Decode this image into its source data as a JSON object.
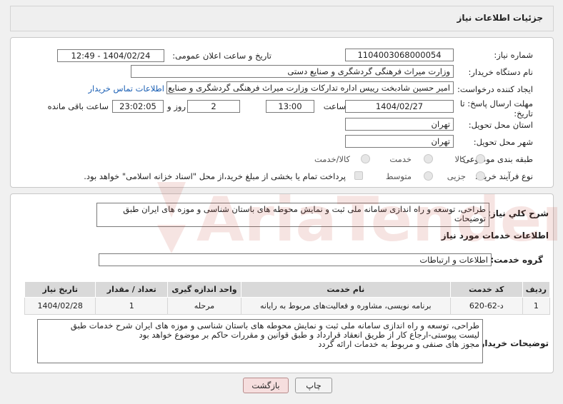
{
  "header": {
    "title": "جزئیات اطلاعات نیاز"
  },
  "info": {
    "need_number_label": "شماره نیاز:",
    "need_number": "1104003068000054",
    "announce_label": "تاریخ و ساعت اعلان عمومی:",
    "announce_value": "1404/02/24 - 12:49",
    "buyer_org_label": "نام دستگاه خریدار:",
    "buyer_org": "وزارت میراث فرهنگی  گردشگری و صنایع دستی",
    "creator_label": "ایجاد کننده درخواست:",
    "creator": "امیر حسین شادبخت رییس اداره تدارکات وزارت میراث فرهنگی  گردشگری و صنایع دستی",
    "contact_link": "اطلاعات تماس خریدار",
    "deadline_label": "مهلت ارسال پاسخ: تا تاریخ:",
    "deadline_date": "1404/02/27",
    "time_label": "ساعت",
    "deadline_time": "13:00",
    "days_value": "2",
    "days_label": "روز و",
    "remaining_time": "23:02:05",
    "remaining_label": "ساعت باقی مانده",
    "province_label": "استان محل تحویل:",
    "province": "تهران",
    "city_label": "شهر محل تحویل:",
    "city": "تهران",
    "category_label": "طبقه بندی موضوعی:",
    "category_options": [
      "کالا",
      "خدمت",
      "کالا/خدمت"
    ],
    "process_label": "نوع فرآیند خرید :",
    "process_options": [
      "جزیی",
      "متوسط"
    ],
    "payment_text": "پرداخت تمام یا بخشی از مبلغ خرید،از محل \"اسناد خزانه اسلامی\" خواهد بود."
  },
  "summary": {
    "label": "شرح کلي نياز:",
    "text": "طراحی، توسعه و راه اندازی سامانه ملی ثبت و نمایش محوطه های باستان شناسی و موزه های ایران طبق توضیحات"
  },
  "services": {
    "section_title": "اطلاعات خدمات مورد نیاز",
    "group_label": "گروه خدمت:",
    "group_value": "اطلاعات و ارتباطات",
    "columns": [
      "ردیف",
      "کد خدمت",
      "نام خدمت",
      "واحد اندازه گیری",
      "تعداد / مقدار",
      "تاریخ نیاز"
    ],
    "rows": [
      [
        "1",
        "د-62-620",
        "برنامه نویسی، مشاوره و فعالیت‌های مربوط به رایانه",
        "مرحله",
        "1",
        "1404/02/28"
      ]
    ]
  },
  "buyer_notes": {
    "label": "توضیحات خریدار:",
    "lines": [
      "طراحی، توسعه و راه اندازی سامانه ملی ثبت و نمایش محوطه های باستان شناسی و موزه های ایران شرح خدمات طبق",
      "لیست پیوستی-ارجاع کار از طریق انعقاد قرارداد و طبق قوانین و مقررات حاکم بر موضوع خواهد بود",
      "مجوز های صنفی و مربوط به خدمات ارائه گردد"
    ]
  },
  "buttons": {
    "print": "چاپ",
    "back": "بازگشت"
  },
  "watermark": {
    "text": "AriaTender.net",
    "color": "#c0392b"
  }
}
